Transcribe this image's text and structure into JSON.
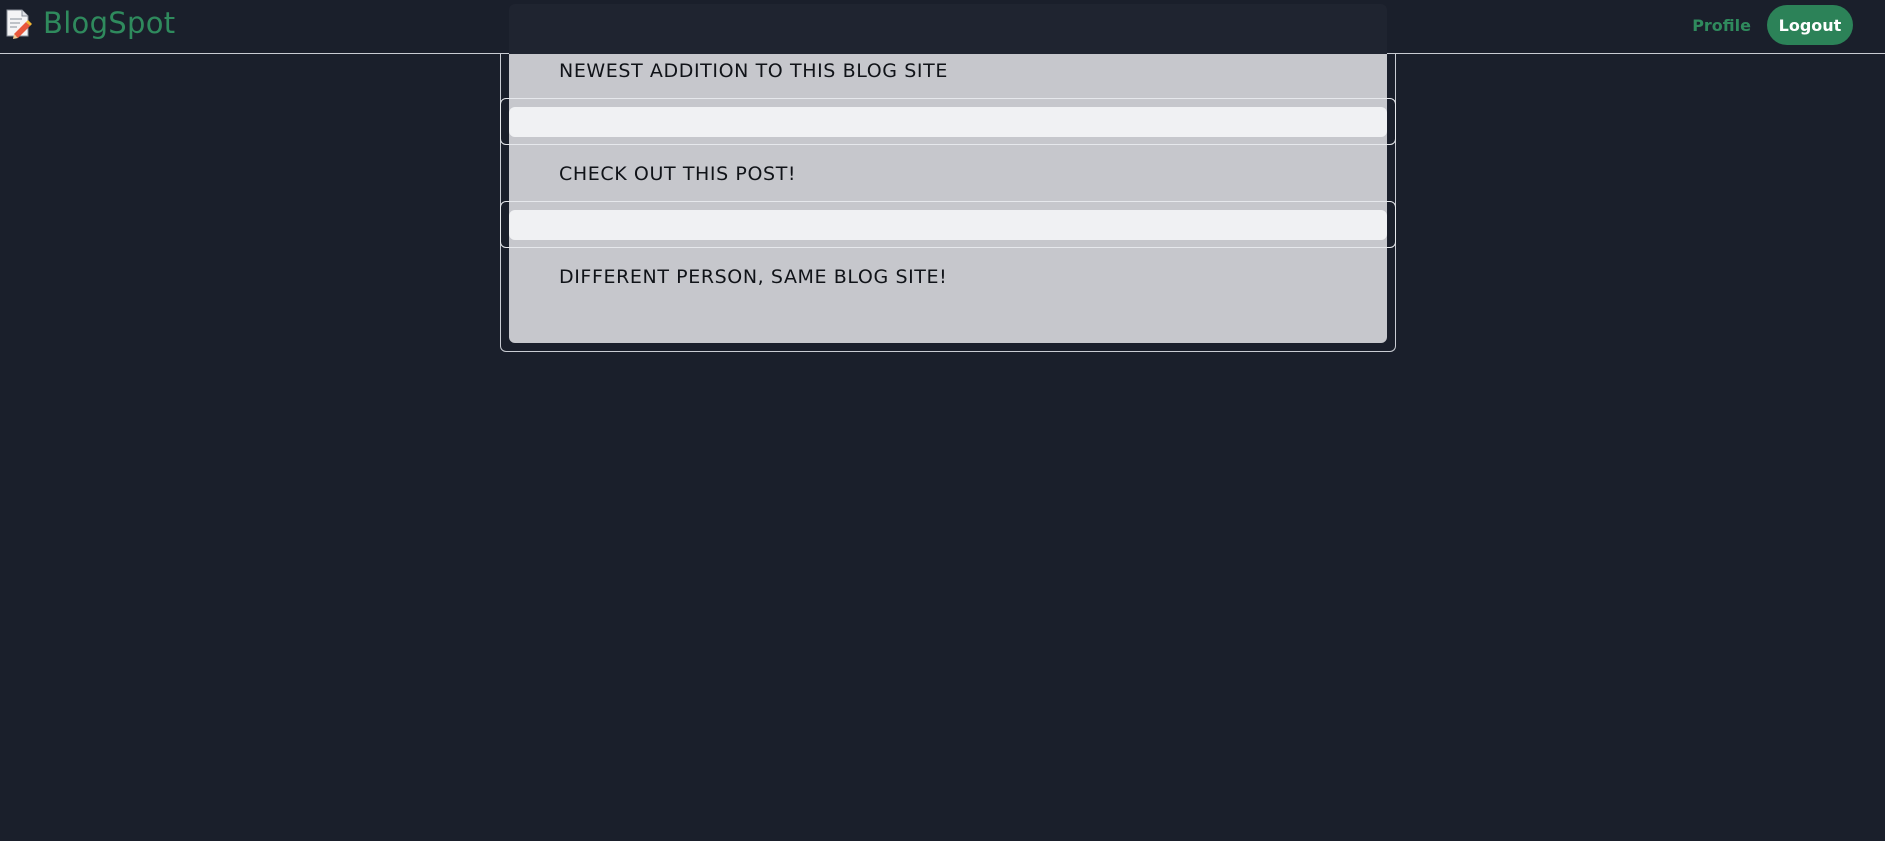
{
  "brand": {
    "name": "BlogSpot",
    "icon": "notepad-pencil-icon"
  },
  "nav": {
    "profile_label": "Profile",
    "logout_label": "Logout"
  },
  "posts": [
    {
      "title": "NEWEST ADDITION TO THIS BLOG SITE"
    },
    {
      "title": "CHECK OUT THIS POST!"
    },
    {
      "title": "DIFFERENT PERSON, SAME BLOG SITE!"
    }
  ],
  "colors": {
    "background": "#1a1f2b",
    "brand_green": "#2f8a5d",
    "button_green": "#2c8258",
    "panel": "#c6c7cc"
  }
}
